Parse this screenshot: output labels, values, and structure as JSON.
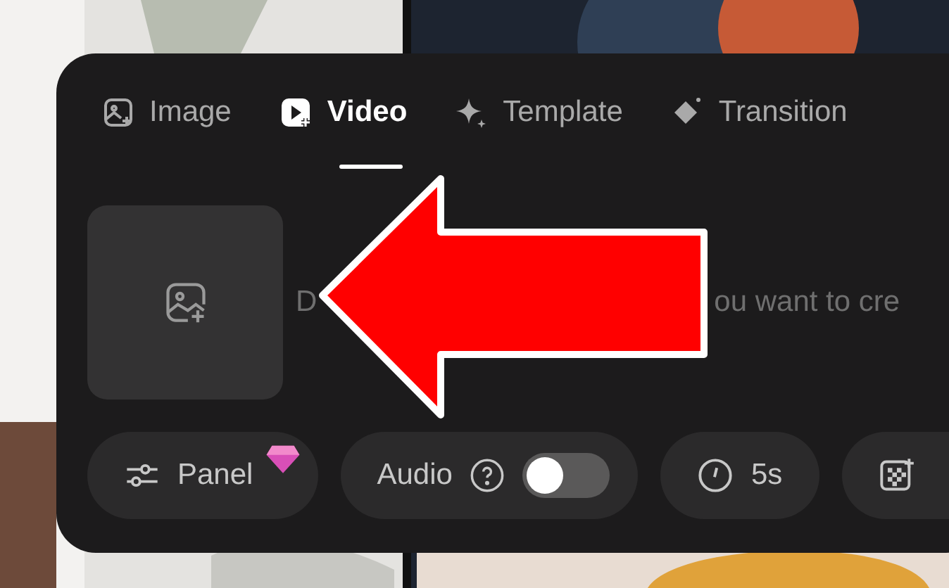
{
  "tabs": [
    {
      "label": "Image",
      "selected": false
    },
    {
      "label": "Video",
      "selected": true
    },
    {
      "label": "Template",
      "selected": false
    },
    {
      "label": "Transition",
      "selected": false
    }
  ],
  "prompt_visible_parts": [
    "D",
    "ou want to cre"
  ],
  "options": [
    {
      "kind": "panel",
      "label": "Panel",
      "premium": true
    },
    {
      "kind": "toggle",
      "label": "Audio",
      "on": false
    },
    {
      "kind": "duration",
      "label": "5s"
    },
    {
      "kind": "effect"
    }
  ]
}
